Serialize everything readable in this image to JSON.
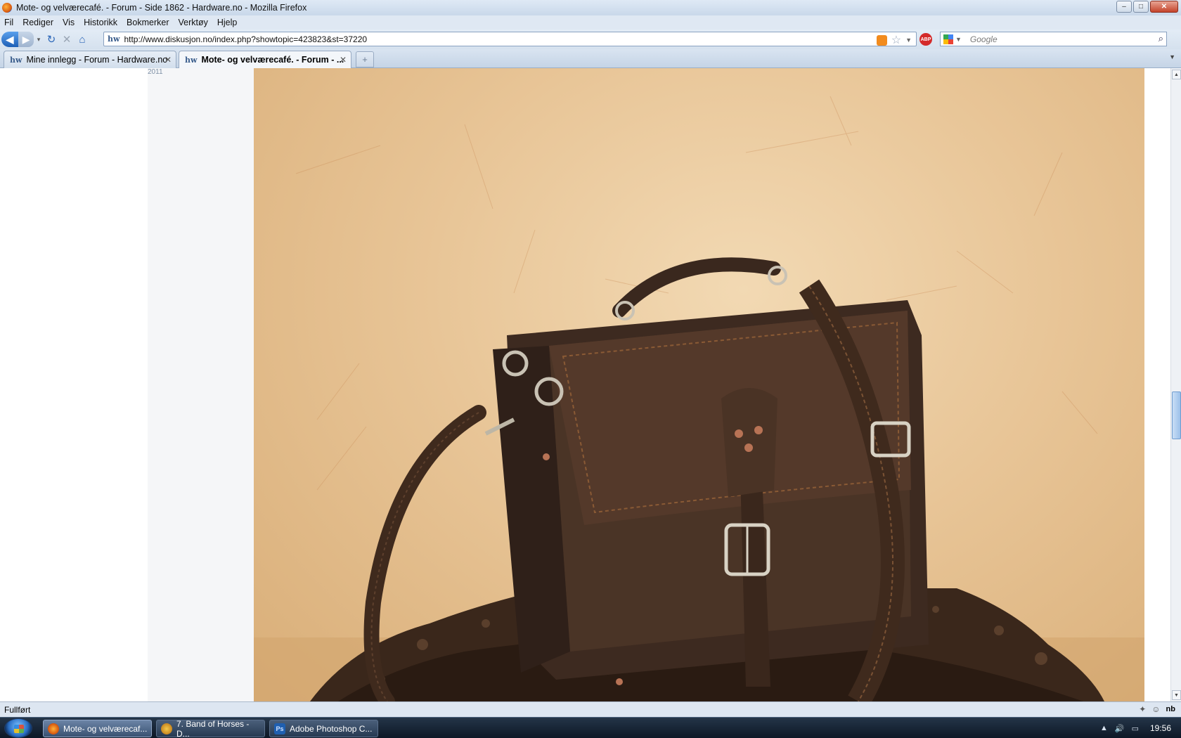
{
  "window": {
    "title": "Mote- og velværecafé. - Forum - Side 1862 - Hardware.no - Mozilla Firefox",
    "buttons": [
      "–",
      "□",
      "✕"
    ]
  },
  "menu": [
    "Fil",
    "Rediger",
    "Vis",
    "Historikk",
    "Bokmerker",
    "Verktøy",
    "Hjelp"
  ],
  "navbar": {
    "url": "http://www.diskusjon.no/index.php?showtopic=423823&st=37220",
    "favicon": "hw",
    "search_placeholder": "Google"
  },
  "tabs": [
    {
      "label": "Mine innlegg - Forum - Hardware.no",
      "favicon": "hw",
      "active": false
    },
    {
      "label": "Mote- og velværecafé. - Forum - ...",
      "favicon": "hw",
      "active": true
    }
  ],
  "content": {
    "year_label": "2011",
    "image_subject": "brown leather satchel briefcase on soil"
  },
  "status": {
    "text": "Fullført",
    "lang": "nb"
  },
  "taskbar": {
    "items": [
      {
        "label": "Mote- og velværecaf...",
        "icon": "firefox-icon",
        "active": true
      },
      {
        "label": "7. Band of Horses - D...",
        "icon": "music-player-icon",
        "active": false
      },
      {
        "label": "Adobe Photoshop C...",
        "icon": "photoshop-icon",
        "active": false
      }
    ],
    "clock": "19:56"
  },
  "colors": {
    "accent": "#2b66b8",
    "titlebar": "#d5e2f1",
    "taskbar": "#1a2a3d",
    "leather": "#4a3426"
  }
}
